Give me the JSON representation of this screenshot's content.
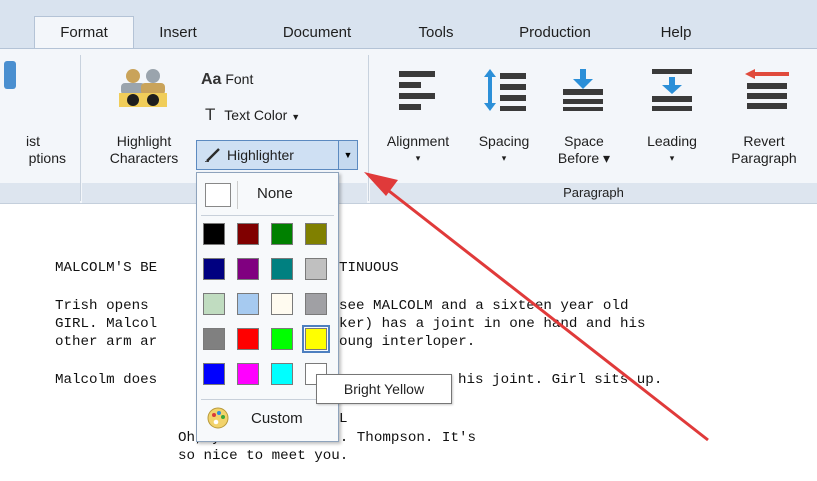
{
  "tabs": [
    {
      "label": "Format",
      "active": true
    },
    {
      "label": "Insert"
    },
    {
      "label": "Document"
    },
    {
      "label": "Tools"
    },
    {
      "label": "Production"
    },
    {
      "label": "Help"
    }
  ],
  "ribbon": {
    "partial_left_line1": "ist",
    "partial_left_line2": "ptions",
    "highlight_characters_line1": "Highlight",
    "highlight_characters_line2": "Characters",
    "font_aa": "Aa",
    "font_label": "Font",
    "text_color_label": "Text Color",
    "highlighter_label": "Highlighter",
    "paragraph_group_label": "Paragraph",
    "paragraph_buttons": [
      {
        "line1": "Alignment",
        "line2": "▾"
      },
      {
        "line1": "Spacing",
        "line2": "▾"
      },
      {
        "line1": "Space",
        "line2": "Before ▾"
      },
      {
        "line1": "Leading",
        "line2": "▾"
      },
      {
        "line1": "Revert",
        "line2": "Paragraph"
      }
    ]
  },
  "highlighter_menu": {
    "none_label": "None",
    "custom_label": "Custom",
    "tooltip": "Bright Yellow",
    "swatches": [
      [
        "#000000",
        "#800000",
        "#008000",
        "#808000"
      ],
      [
        "#000080",
        "#800080",
        "#008080",
        "#c0c0c0"
      ],
      [
        "#c0dcc0",
        "#a6caf0",
        "#fffbf0",
        "#a0a0a4"
      ],
      [
        "#808080",
        "#ff0000",
        "#00ff00",
        "#ffff00"
      ],
      [
        "#0000ff",
        "#ff00ff",
        "#00ffff",
        "#ffffff"
      ]
    ],
    "selected_row": 3,
    "selected_col": 3
  },
  "document": {
    "line1": "MALCOLM'S BE",
    "line1b": "TINUOUS",
    "line2a": "Trish opens",
    "line2b": "see MALCOLM and a sixteen year old",
    "line3a": "GIRL. Malcol",
    "line3b": "ker) has a joint in one hand and his",
    "line4a": "other arm ar",
    "line4b": "oung interloper.",
    "line5a": "Malcolm does",
    "line5b": "his joint. Girl sits up.",
    "char_frag": "L",
    "dialog1": "Oh, you must be Mrs. Thompson. It's",
    "dialog2": "so nice to meet you."
  }
}
